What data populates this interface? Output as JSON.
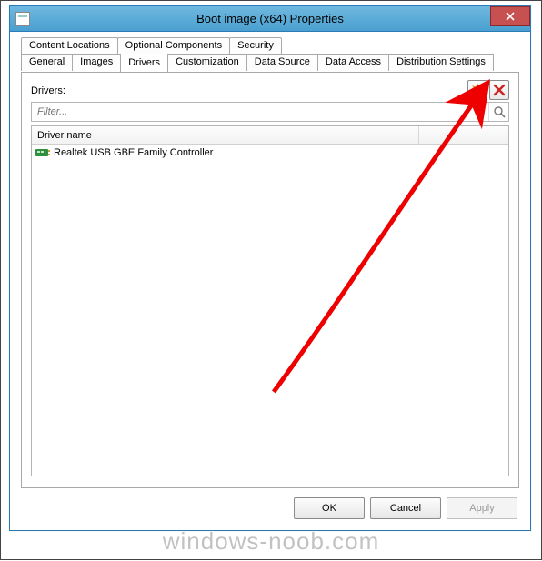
{
  "window": {
    "title": "Boot image (x64) Properties"
  },
  "tabs": {
    "row1": [
      {
        "label": "Content Locations"
      },
      {
        "label": "Optional Components"
      },
      {
        "label": "Security"
      }
    ],
    "row2": [
      {
        "label": "General"
      },
      {
        "label": "Images"
      },
      {
        "label": "Drivers",
        "active": true
      },
      {
        "label": "Customization"
      },
      {
        "label": "Data Source"
      },
      {
        "label": "Data Access"
      },
      {
        "label": "Distribution Settings"
      }
    ]
  },
  "drivers": {
    "section_label": "Drivers:",
    "filter_placeholder": "Filter...",
    "column_header": "Driver name",
    "rows": [
      {
        "name": "Realtek USB GBE Family Controller"
      }
    ]
  },
  "buttons": {
    "ok": "OK",
    "cancel": "Cancel",
    "apply": "Apply"
  },
  "watermark": "windows-noob.com"
}
